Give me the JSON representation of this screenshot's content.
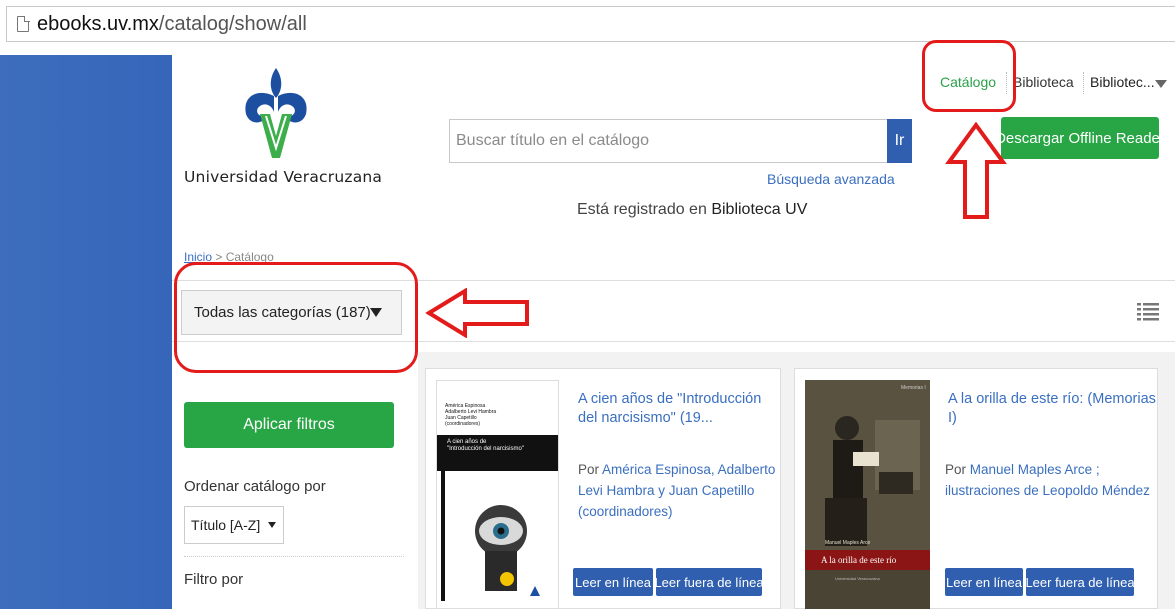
{
  "browser": {
    "url_domain": "ebooks.uv.mx",
    "url_path": "/catalog/show/all"
  },
  "header": {
    "logo_text": "Universidad Veracruzana",
    "search_placeholder": "Buscar título en el catálogo",
    "search_button": "Ir",
    "advanced_search": "Búsqueda avanzada",
    "registered_prefix": "Está registrado en",
    "registered_library": "Biblioteca UV",
    "download_button": "Descargar Offline Reader"
  },
  "nav": {
    "catalogo": "Catálogo",
    "biblioteca": "Biblioteca",
    "user_menu": "Bibliotec..."
  },
  "breadcrumb": {
    "home": "Inicio",
    "separator": ">",
    "current": "Catálogo"
  },
  "categories": {
    "selected": "Todas las categorías (187)"
  },
  "sidebar": {
    "apply_filters": "Aplicar filtros",
    "sort_label": "Ordenar catálogo por",
    "sort_value": "Título [A-Z]",
    "filter_label": "Filtro por"
  },
  "books": [
    {
      "title": "A cien años de \"Introducción del narcisismo\" (19...",
      "by_prefix": "Por",
      "authors": "América Espinosa, Adalberto Levi Hambra y Juan Capetillo (coordinadores)",
      "read_online": "Leer en línea",
      "read_offline": "Leer fuera de línea",
      "cover_authors": "América Espinosa\nAdalberto Levi Hambra\nJuan Capetillo\n(coordinadores)",
      "cover_title": "A cien años de\n\"Introducción del narcisismo\""
    },
    {
      "title": "A la orilla de este río: (Memorias I)",
      "by_prefix": "Por",
      "authors": "Manuel Maples Arce ; ilustraciones de Leopoldo Méndez",
      "read_online": "Leer en línea",
      "read_offline": "Leer fuera de línea",
      "cover_series": "Memorias I",
      "cover_author": "Manuel Maples Arce",
      "cover_title": "A la orilla de este río",
      "cover_publisher": "Universidad Veracruzana"
    }
  ],
  "colors": {
    "primary_blue": "#2f5fae",
    "green": "#28a645",
    "annotation_red": "#e31b1b"
  }
}
